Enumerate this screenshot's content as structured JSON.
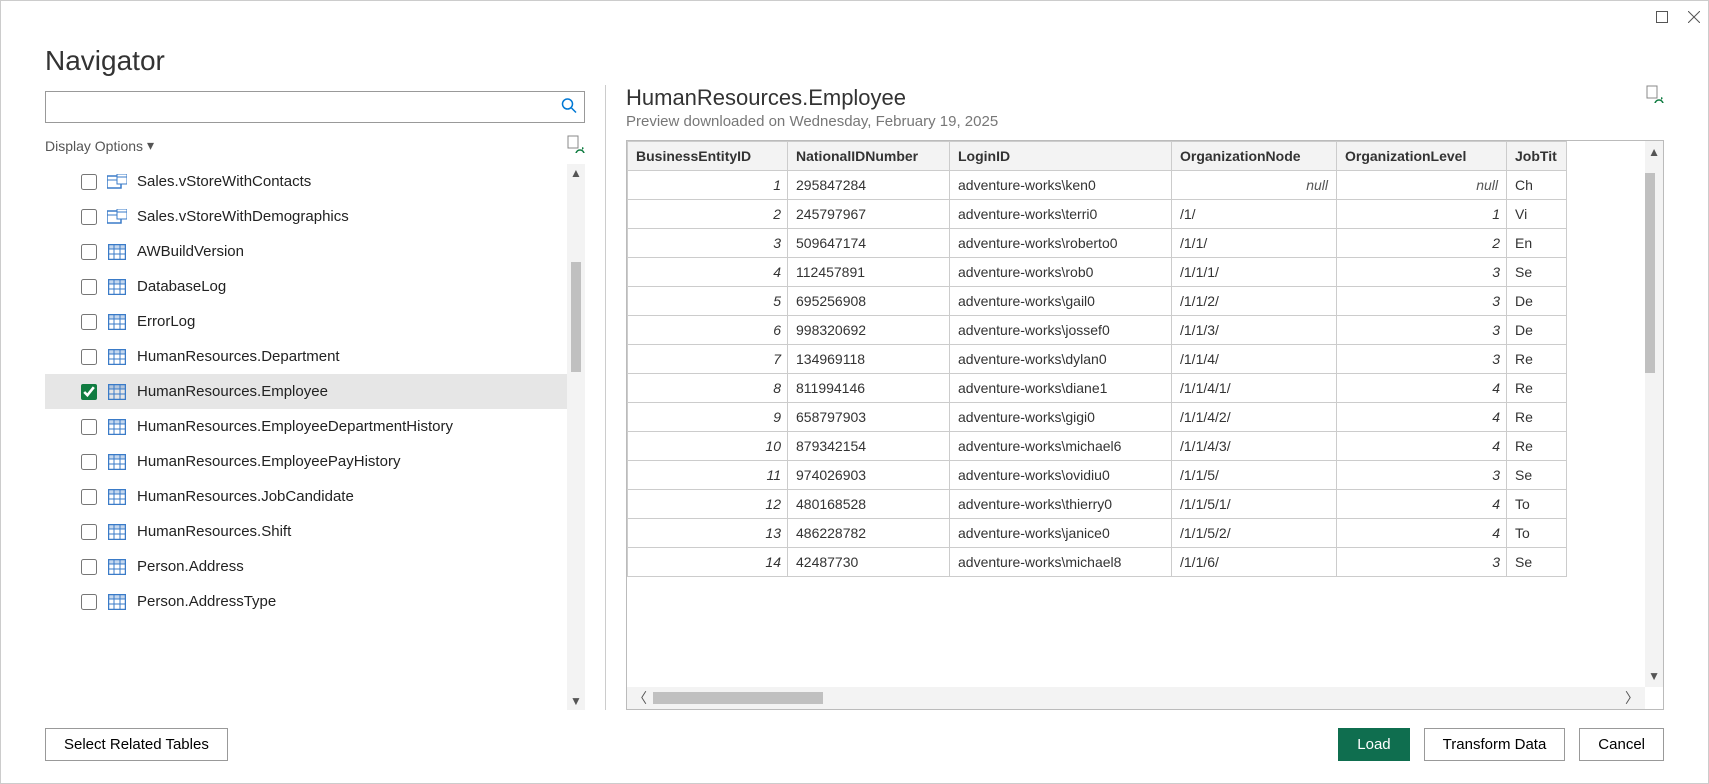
{
  "window": {
    "title": "Navigator"
  },
  "search": {
    "placeholder": ""
  },
  "display_options_label": "Display Options",
  "tree": [
    {
      "label": "Sales.vStoreWithContacts",
      "type": "view",
      "checked": false
    },
    {
      "label": "Sales.vStoreWithDemographics",
      "type": "view",
      "checked": false
    },
    {
      "label": "AWBuildVersion",
      "type": "table",
      "checked": false
    },
    {
      "label": "DatabaseLog",
      "type": "table",
      "checked": false
    },
    {
      "label": "ErrorLog",
      "type": "table",
      "checked": false
    },
    {
      "label": "HumanResources.Department",
      "type": "table",
      "checked": false
    },
    {
      "label": "HumanResources.Employee",
      "type": "table",
      "checked": true,
      "selected": true
    },
    {
      "label": "HumanResources.EmployeeDepartmentHistory",
      "type": "table",
      "checked": false
    },
    {
      "label": "HumanResources.EmployeePayHistory",
      "type": "table",
      "checked": false
    },
    {
      "label": "HumanResources.JobCandidate",
      "type": "table",
      "checked": false
    },
    {
      "label": "HumanResources.Shift",
      "type": "table",
      "checked": false
    },
    {
      "label": "Person.Address",
      "type": "table",
      "checked": false
    },
    {
      "label": "Person.AddressType",
      "type": "table",
      "checked": false
    }
  ],
  "preview": {
    "title": "HumanResources.Employee",
    "subtitle": "Preview downloaded on Wednesday, February 19, 2025",
    "columns": [
      "BusinessEntityID",
      "NationalIDNumber",
      "LoginID",
      "OrganizationNode",
      "OrganizationLevel",
      "JobTit"
    ],
    "rows": [
      {
        "id": "1",
        "nid": "295847284",
        "login": "adventure-works\\ken0",
        "org": "null",
        "level": "null",
        "jt": "Ch"
      },
      {
        "id": "2",
        "nid": "245797967",
        "login": "adventure-works\\terri0",
        "org": "/1/",
        "level": "1",
        "jt": "Vi"
      },
      {
        "id": "3",
        "nid": "509647174",
        "login": "adventure-works\\roberto0",
        "org": "/1/1/",
        "level": "2",
        "jt": "En"
      },
      {
        "id": "4",
        "nid": "112457891",
        "login": "adventure-works\\rob0",
        "org": "/1/1/1/",
        "level": "3",
        "jt": "Se"
      },
      {
        "id": "5",
        "nid": "695256908",
        "login": "adventure-works\\gail0",
        "org": "/1/1/2/",
        "level": "3",
        "jt": "De"
      },
      {
        "id": "6",
        "nid": "998320692",
        "login": "adventure-works\\jossef0",
        "org": "/1/1/3/",
        "level": "3",
        "jt": "De"
      },
      {
        "id": "7",
        "nid": "134969118",
        "login": "adventure-works\\dylan0",
        "org": "/1/1/4/",
        "level": "3",
        "jt": "Re"
      },
      {
        "id": "8",
        "nid": "811994146",
        "login": "adventure-works\\diane1",
        "org": "/1/1/4/1/",
        "level": "4",
        "jt": "Re"
      },
      {
        "id": "9",
        "nid": "658797903",
        "login": "adventure-works\\gigi0",
        "org": "/1/1/4/2/",
        "level": "4",
        "jt": "Re"
      },
      {
        "id": "10",
        "nid": "879342154",
        "login": "adventure-works\\michael6",
        "org": "/1/1/4/3/",
        "level": "4",
        "jt": "Re"
      },
      {
        "id": "11",
        "nid": "974026903",
        "login": "adventure-works\\ovidiu0",
        "org": "/1/1/5/",
        "level": "3",
        "jt": "Se"
      },
      {
        "id": "12",
        "nid": "480168528",
        "login": "adventure-works\\thierry0",
        "org": "/1/1/5/1/",
        "level": "4",
        "jt": "To"
      },
      {
        "id": "13",
        "nid": "486228782",
        "login": "adventure-works\\janice0",
        "org": "/1/1/5/2/",
        "level": "4",
        "jt": "To"
      },
      {
        "id": "14",
        "nid": "42487730",
        "login": "adventure-works\\michael8",
        "org": "/1/1/6/",
        "level": "3",
        "jt": "Se"
      }
    ]
  },
  "footer": {
    "select_related": "Select Related Tables",
    "load": "Load",
    "transform": "Transform Data",
    "cancel": "Cancel"
  }
}
